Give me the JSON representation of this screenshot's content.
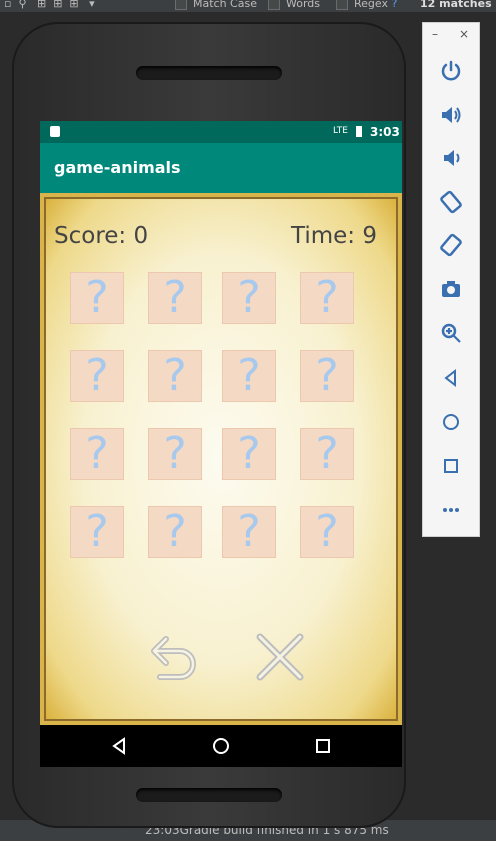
{
  "ide": {
    "toolbar": {
      "match_case": "Match Case",
      "words": "Words",
      "regex": "Regex",
      "help": "?",
      "matches": "12 matches"
    },
    "status_bar": {
      "text": "23:03Gradle build finished in 1 s 875 ms"
    }
  },
  "phone": {
    "status_bar": {
      "signal": "LTE",
      "time": "3:03"
    },
    "app_bar": {
      "title": "game-animals"
    },
    "game": {
      "score_label": "Score:",
      "score_value": "0",
      "time_label": "Time:",
      "time_value": "9",
      "cards": [
        "?",
        "?",
        "?",
        "?",
        "?",
        "?",
        "?",
        "?",
        "?",
        "?",
        "?",
        "?",
        "?",
        "?",
        "?",
        "?"
      ]
    }
  },
  "emulator": {
    "minimize": "–",
    "close": "×",
    "tools": [
      "power-icon",
      "volume-up-icon",
      "volume-down-icon",
      "rotate-left-icon",
      "rotate-right-icon",
      "camera-icon",
      "zoom-icon",
      "back-icon",
      "home-icon",
      "overview-icon",
      "more-icon"
    ]
  },
  "colors": {
    "status_bar": "#00695c",
    "app_bar": "#00897b",
    "card": "#f4d9c4",
    "question_mark": "#a8c9ee"
  }
}
